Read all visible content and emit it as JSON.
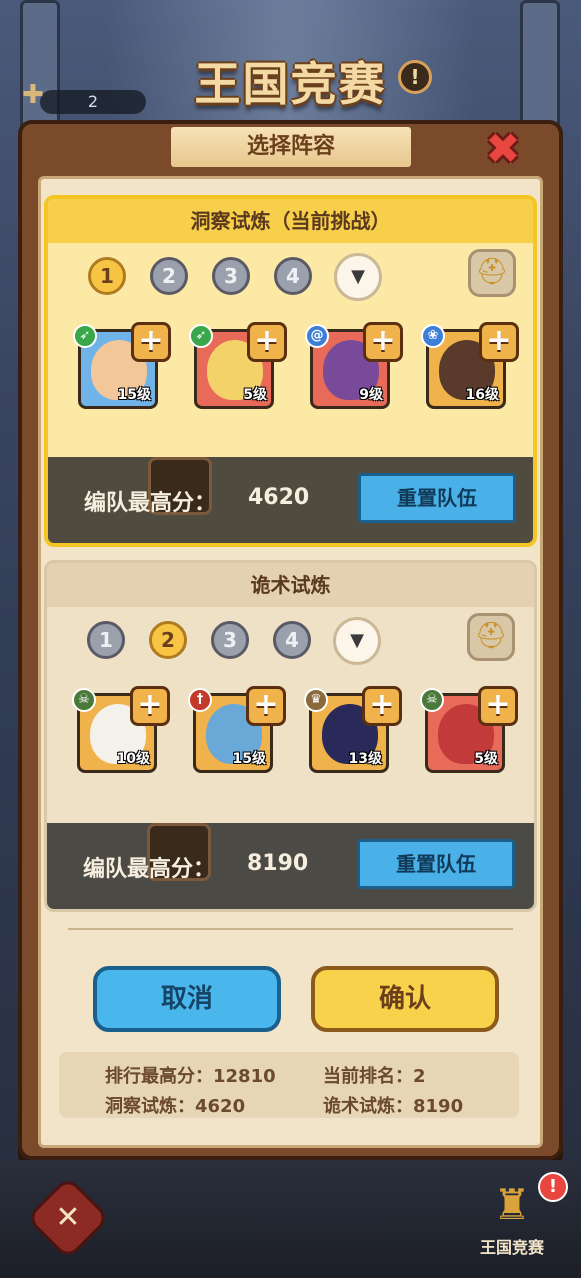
{
  "header": {
    "title": "王国竞赛",
    "info_glyph": "!",
    "counter_value": "2",
    "counter_icon": "puzzle-plus-icon"
  },
  "dialog": {
    "title": "选择阵容",
    "close_glyph": "✖"
  },
  "teams": [
    {
      "name": "洞察试炼（当前挑战）",
      "slots": [
        "1",
        "2",
        "3",
        "4"
      ],
      "selected_slot": "1",
      "dropdown_glyph": "▼",
      "heroes": [
        {
          "level": "15级",
          "badge": "bow-icon",
          "badge_color": "#3aa84a",
          "card_color": "#6fb3e8",
          "face_color": "#f2c89a"
        },
        {
          "level": "5级",
          "badge": "bow-icon",
          "badge_color": "#3aa84a",
          "card_color": "#e86b5a",
          "face_color": "#f4d26a"
        },
        {
          "level": "9级",
          "badge": "spiral-icon",
          "badge_color": "#3d7fd6",
          "card_color": "#e86b5a",
          "face_color": "#7a4a9a"
        },
        {
          "level": "16级",
          "badge": "paw-icon",
          "badge_color": "#3d7fd6",
          "card_color": "#f0b24a",
          "face_color": "#5a3a2a"
        }
      ],
      "score_label": "编队最高分：",
      "score_value": "4620",
      "reset_label": "重置队伍"
    },
    {
      "name": "诡术试炼",
      "slots": [
        "1",
        "2",
        "3",
        "4"
      ],
      "selected_slot": "2",
      "dropdown_glyph": "▼",
      "heroes": [
        {
          "level": "10级",
          "badge": "skull-icon",
          "badge_color": "#4a7a3a",
          "card_color": "#f0b24a",
          "face_color": "#f4f0ea"
        },
        {
          "level": "15级",
          "badge": "sword-icon",
          "badge_color": "#c23a2a",
          "card_color": "#f0b24a",
          "face_color": "#6aa8d8"
        },
        {
          "level": "13级",
          "badge": "crown-icon",
          "badge_color": "#8a6a3a",
          "card_color": "#f0b24a",
          "face_color": "#2a2a5a"
        },
        {
          "level": "5级",
          "badge": "skull-icon",
          "badge_color": "#4a7a3a",
          "card_color": "#e86b5a",
          "face_color": "#c23a3a"
        }
      ],
      "score_label": "编队最高分：",
      "score_value": "8190",
      "reset_label": "重置队伍"
    }
  ],
  "buttons": {
    "cancel": "取消",
    "confirm": "确认"
  },
  "summary": {
    "rank_high_score": "排行最高分：12810",
    "current_rank": "当前排名：2",
    "insight_trial": "洞察试炼：4620",
    "trick_trial": "诡术试炼：8190"
  },
  "bottom_nav": {
    "battle_icon": "crossed-swords-icon",
    "trophy_icon": "trophy-icon",
    "alert_glyph": "!",
    "label": "王国竞赛"
  }
}
